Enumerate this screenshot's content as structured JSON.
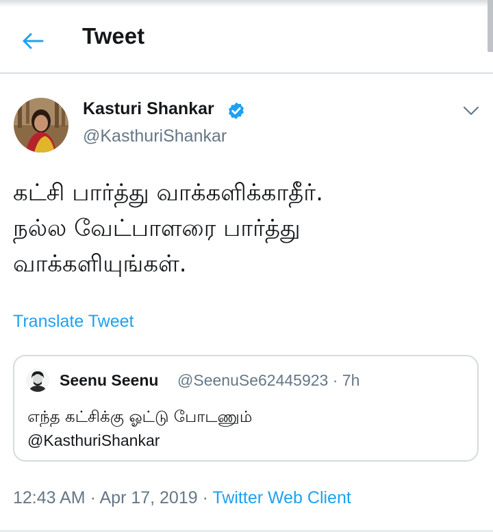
{
  "header": {
    "title": "Tweet"
  },
  "tweet": {
    "author_name": "Kasturi Shankar",
    "author_handle": "@KasthuriShankar",
    "text": "கட்சி பார்த்து வாக்களிக்காதீர்.\nநல்ல வேட்பாளரை பார்த்து\nவாக்களியுங்கள்.",
    "translate_label": "Translate Tweet",
    "time": "12:43 AM",
    "date": "Apr 17, 2019",
    "source": "Twitter Web Client",
    "separator": " · "
  },
  "quoted": {
    "name": "Seenu Seenu",
    "handle": "@SeenuSe62445923",
    "separator": " · ",
    "time": "7h",
    "text": "எந்த கட்சிக்கு ஓட்டு போடணும்",
    "mention": "@KasthuriShankar"
  },
  "colors": {
    "accent": "#1da1f2",
    "muted": "#657786",
    "text": "#14171a",
    "border": "#d5dade"
  }
}
